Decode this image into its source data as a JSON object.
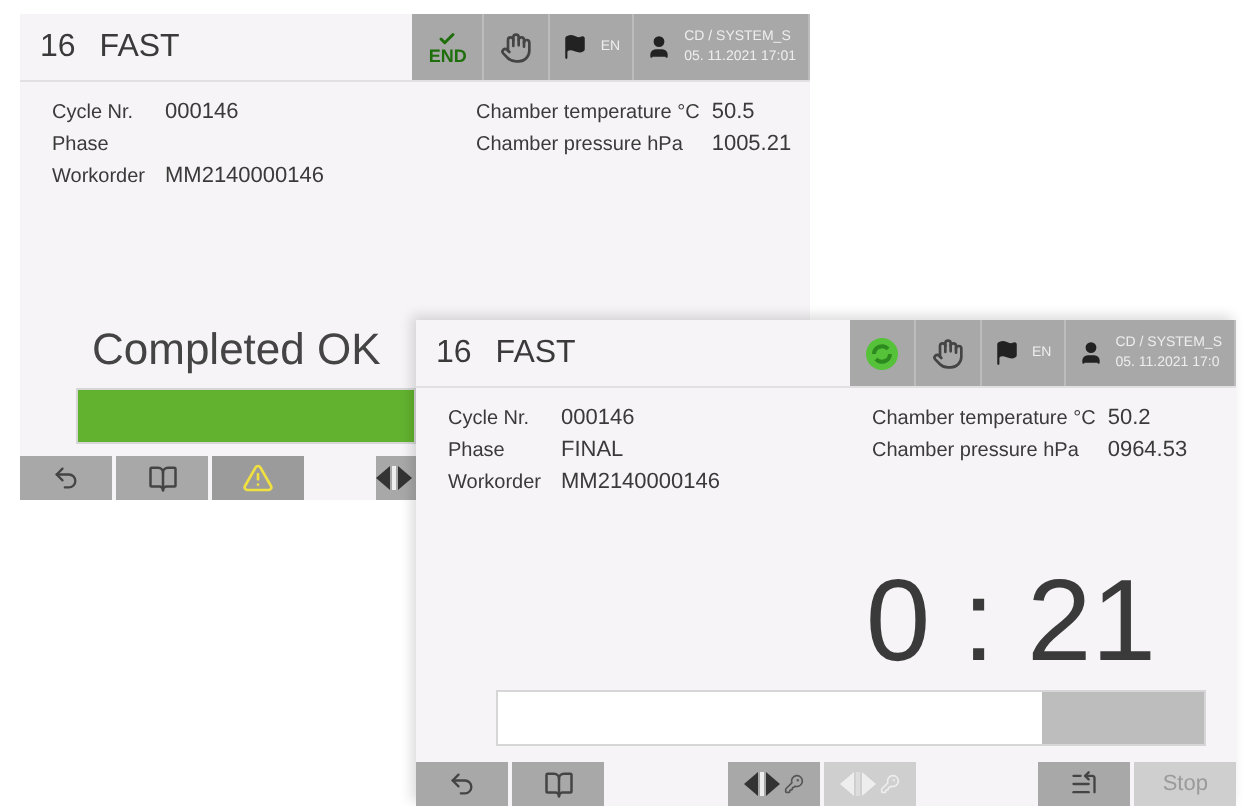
{
  "windows": [
    {
      "program_nr": "16",
      "program": "FAST",
      "status": {
        "kind": "end",
        "label": "END"
      },
      "language": "EN",
      "user": "CD / SYSTEM_S",
      "datetime": "05. 11.2021  17:01",
      "fields": [
        {
          "label": "Cycle Nr.",
          "value": "000146"
        },
        {
          "label": "Phase"
        },
        {
          "label": "Workorder",
          "value": "MM2140000146"
        }
      ],
      "readings": [
        {
          "label": "Chamber temperature °C",
          "value": "50.5"
        },
        {
          "label": "Chamber pressure hPa",
          "value": "1005.21"
        }
      ],
      "main": {
        "kind": "message",
        "text": "Completed OK"
      },
      "progress": {
        "level": 1,
        "complete": true
      },
      "toolbar": {
        "left": [
          {
            "kind": "back",
            "disabled": false
          },
          {
            "kind": "manual",
            "disabled": false
          },
          {
            "kind": "warning",
            "disabled": false
          }
        ],
        "center": [
          {
            "kind": "door",
            "disabled": false
          }
        ]
      }
    },
    {
      "program_nr": "16",
      "program": "FAST",
      "status": {
        "kind": "running"
      },
      "language": "EN",
      "user": "CD / SYSTEM_S",
      "datetime": "05. 11.2021  17:0",
      "fields": [
        {
          "label": "Cycle Nr.",
          "value": "000146"
        },
        {
          "label": "Phase",
          "value": "FINAL"
        },
        {
          "label": "Workorder",
          "value": "MM2140000146"
        }
      ],
      "readings": [
        {
          "label": "Chamber temperature °C",
          "value": "50.2"
        },
        {
          "label": "Chamber pressure hPa",
          "value": "0964.53"
        }
      ],
      "main": {
        "kind": "timer",
        "text": "0 : 21"
      },
      "progress": {
        "level": 0.77,
        "complete": false
      },
      "toolbar": {
        "left": [
          {
            "kind": "back",
            "disabled": false
          },
          {
            "kind": "manual",
            "disabled": false
          }
        ],
        "center": [
          {
            "kind": "door",
            "disabled": false
          },
          {
            "kind": "door",
            "disabled": true
          }
        ],
        "right": [
          {
            "kind": "program",
            "disabled": false
          },
          {
            "kind": "text",
            "label": "Stop",
            "disabled": true
          }
        ]
      }
    }
  ]
}
